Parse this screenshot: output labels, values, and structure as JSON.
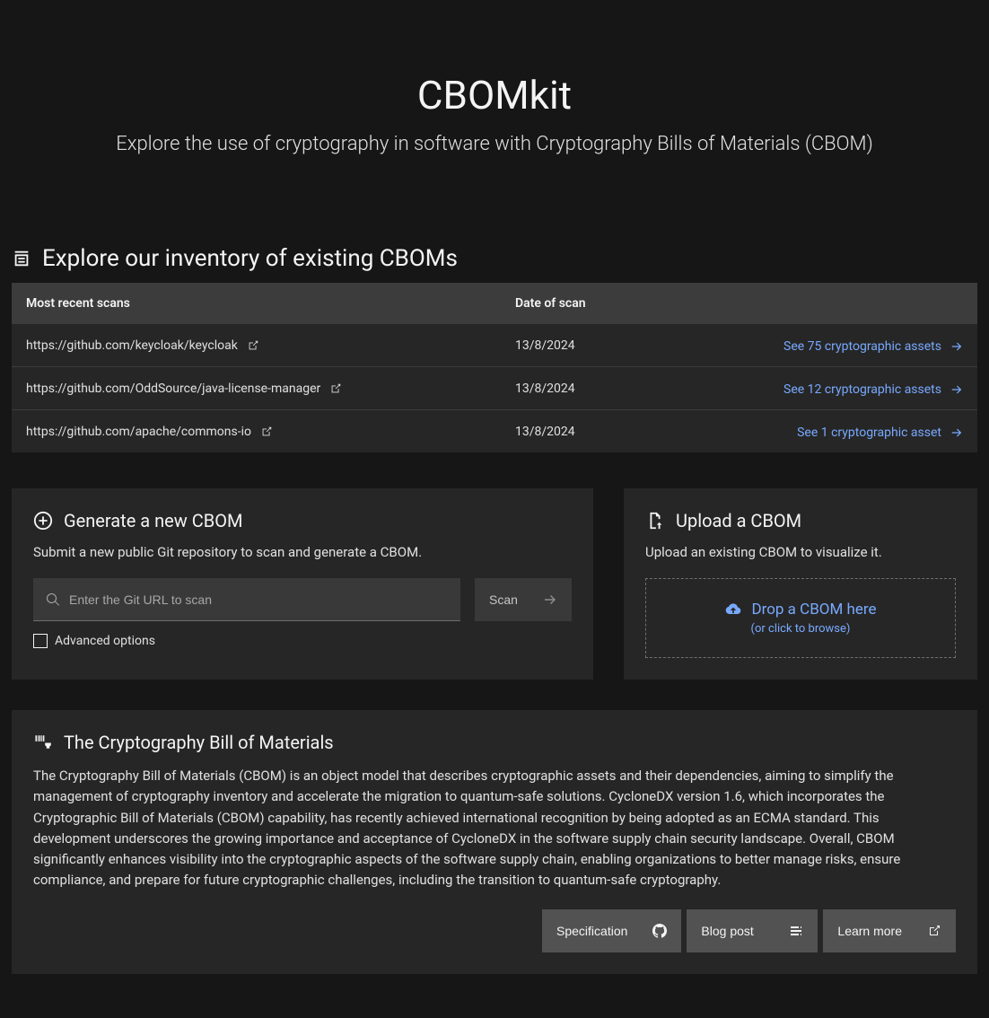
{
  "hero": {
    "title": "CBOMkit",
    "subtitle": "Explore the use of cryptography in software with Cryptography Bills of Materials (CBOM)"
  },
  "inventory": {
    "heading": "Explore our inventory of existing CBOMs",
    "col1_label": "Most recent scans",
    "col2_label": "Date of scan",
    "rows": [
      {
        "url": "https://github.com/keycloak/keycloak",
        "date": "13/8/2024",
        "action": "See 75 cryptographic assets"
      },
      {
        "url": "https://github.com/OddSource/java-license-manager",
        "date": "13/8/2024",
        "action": "See 12 cryptographic assets"
      },
      {
        "url": "https://github.com/apache/commons-io",
        "date": "13/8/2024",
        "action": "See 1 cryptographic asset"
      }
    ]
  },
  "generate": {
    "heading": "Generate a new CBOM",
    "desc": "Submit a new public Git repository to scan and generate a CBOM.",
    "placeholder": "Enter the Git URL to scan",
    "scan_label": "Scan",
    "advanced_label": "Advanced options"
  },
  "upload": {
    "heading": "Upload a CBOM",
    "desc": "Upload an existing CBOM to visualize it.",
    "drop_main": "Drop a CBOM here",
    "drop_sub": "(or click to browse)"
  },
  "info": {
    "heading": "The Cryptography Bill of Materials",
    "desc": "The Cryptography Bill of Materials (CBOM) is an object model that describes cryptographic assets and their dependencies, aiming to simplify the management of cryptography inventory and accelerate the migration to quantum-safe solutions. CycloneDX version 1.6, which incorporates the Cryptographic Bill of Materials (CBOM) capability, has recently achieved international recognition by being adopted as an ECMA standard. This development underscores the growing importance and acceptance of CycloneDX in the software supply chain security landscape. Overall, CBOM significantly enhances visibility into the cryptographic aspects of the software supply chain, enabling organizations to better manage risks, ensure compliance, and prepare for future cryptographic challenges, including the transition to quantum-safe cryptography.",
    "buttons": {
      "spec": "Specification",
      "blog": "Blog post",
      "learn": "Learn more"
    }
  }
}
